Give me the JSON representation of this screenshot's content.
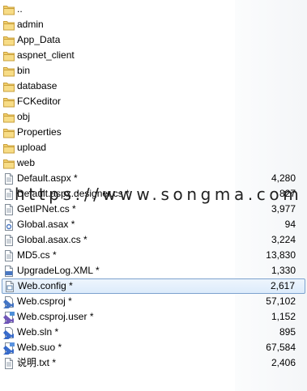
{
  "files": [
    {
      "name": "..",
      "icon": "folder-icon",
      "size": ""
    },
    {
      "name": "admin",
      "icon": "folder-icon",
      "size": ""
    },
    {
      "name": "App_Data",
      "icon": "folder-icon",
      "size": ""
    },
    {
      "name": "aspnet_client",
      "icon": "folder-icon",
      "size": ""
    },
    {
      "name": "bin",
      "icon": "folder-icon",
      "size": ""
    },
    {
      "name": "database",
      "icon": "folder-icon",
      "size": ""
    },
    {
      "name": "FCKeditor",
      "icon": "folder-icon",
      "size": ""
    },
    {
      "name": "obj",
      "icon": "folder-icon",
      "size": ""
    },
    {
      "name": "Properties",
      "icon": "folder-icon",
      "size": ""
    },
    {
      "name": "upload",
      "icon": "folder-icon",
      "size": ""
    },
    {
      "name": "web",
      "icon": "folder-icon",
      "size": ""
    },
    {
      "name": "Default.aspx *",
      "icon": "aspx-file-icon",
      "size": "4,280"
    },
    {
      "name": "Default.aspx.designer.cs *",
      "icon": "text-file-icon",
      "size": "827"
    },
    {
      "name": "GetIPNet.cs *",
      "icon": "text-file-icon",
      "size": "3,977"
    },
    {
      "name": "Global.asax *",
      "icon": "asax-file-icon",
      "size": "94"
    },
    {
      "name": "Global.asax.cs *",
      "icon": "text-file-icon",
      "size": "3,224"
    },
    {
      "name": "MD5.cs *",
      "icon": "text-file-icon",
      "size": "13,830"
    },
    {
      "name": "UpgradeLog.XML *",
      "icon": "xml-file-icon",
      "size": "1,330"
    },
    {
      "name": "Web.config *",
      "icon": "config-file-icon",
      "size": "2,617"
    },
    {
      "name": "Web.csproj *",
      "icon": "csproj-file-icon",
      "size": "57,102"
    },
    {
      "name": "Web.csproj.user *",
      "icon": "csproj-user-file-icon",
      "size": "1,152"
    },
    {
      "name": "Web.sln *",
      "icon": "sln-file-icon",
      "size": "895"
    },
    {
      "name": "Web.suo *",
      "icon": "suo-file-icon",
      "size": "67,584"
    },
    {
      "name": "说明.txt *",
      "icon": "text-file-icon",
      "size": "2,406"
    }
  ],
  "selected_index": 18,
  "watermark": "https://www.songma.com",
  "colors": {
    "folder": "#e8c15a",
    "selection_border": "#7da2ce",
    "selection_fill": "#dcebfb"
  }
}
